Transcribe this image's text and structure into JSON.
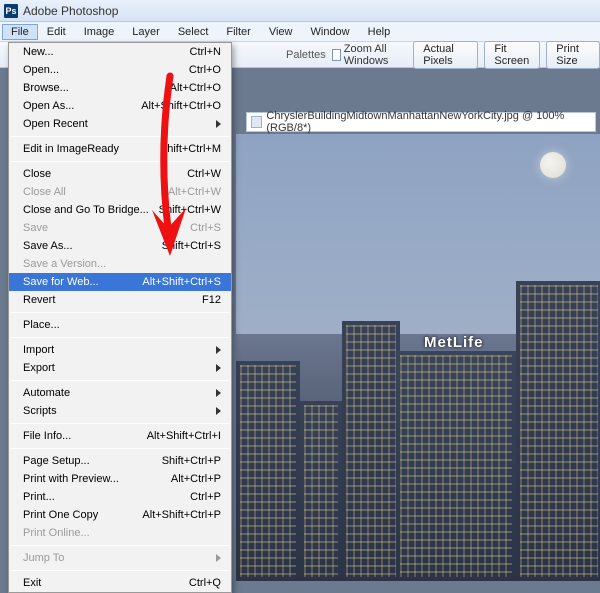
{
  "app": {
    "title": "Adobe Photoshop",
    "icon_label": "Ps"
  },
  "menubar": {
    "items": [
      "File",
      "Edit",
      "Image",
      "Layer",
      "Select",
      "Filter",
      "View",
      "Window",
      "Help"
    ],
    "open_index": 0
  },
  "optionsbar": {
    "palettes_label": "Palettes",
    "zoom_checkbox_label": "Zoom All Windows",
    "buttons": {
      "actual": "Actual Pixels",
      "fit": "Fit Screen",
      "printsize": "Print Size"
    }
  },
  "document": {
    "icon": "document-icon",
    "filename": "ChryslerBuildingMidtownManhattanNewYorkCity.jpg",
    "zoom": "100%",
    "mode": "RGB/8*"
  },
  "dropdown": {
    "items": [
      {
        "label": "New...",
        "shortcut": "Ctrl+N"
      },
      {
        "label": "Open...",
        "shortcut": "Ctrl+O"
      },
      {
        "label": "Browse...",
        "shortcut": "Alt+Ctrl+O"
      },
      {
        "label": "Open As...",
        "shortcut": "Alt+Shift+Ctrl+O"
      },
      {
        "label": "Open Recent",
        "submenu": true
      },
      {
        "sep": true
      },
      {
        "label": "Edit in ImageReady",
        "shortcut": "Shift+Ctrl+M"
      },
      {
        "sep": true
      },
      {
        "label": "Close",
        "shortcut": "Ctrl+W"
      },
      {
        "label": "Close All",
        "shortcut": "Alt+Ctrl+W",
        "disabled": true
      },
      {
        "label": "Close and Go To Bridge...",
        "shortcut": "Shift+Ctrl+W"
      },
      {
        "label": "Save",
        "shortcut": "Ctrl+S",
        "disabled": true
      },
      {
        "label": "Save As...",
        "shortcut": "Shift+Ctrl+S"
      },
      {
        "label": "Save a Version...",
        "disabled": true
      },
      {
        "label": "Save for Web...",
        "shortcut": "Alt+Shift+Ctrl+S",
        "highlight": true
      },
      {
        "label": "Revert",
        "shortcut": "F12"
      },
      {
        "sep": true
      },
      {
        "label": "Place..."
      },
      {
        "sep": true
      },
      {
        "label": "Import",
        "submenu": true
      },
      {
        "label": "Export",
        "submenu": true
      },
      {
        "sep": true
      },
      {
        "label": "Automate",
        "submenu": true
      },
      {
        "label": "Scripts",
        "submenu": true
      },
      {
        "sep": true
      },
      {
        "label": "File Info...",
        "shortcut": "Alt+Shift+Ctrl+I"
      },
      {
        "sep": true
      },
      {
        "label": "Page Setup...",
        "shortcut": "Shift+Ctrl+P"
      },
      {
        "label": "Print with Preview...",
        "shortcut": "Alt+Ctrl+P"
      },
      {
        "label": "Print...",
        "shortcut": "Ctrl+P"
      },
      {
        "label": "Print One Copy",
        "shortcut": "Alt+Shift+Ctrl+P"
      },
      {
        "label": "Print Online...",
        "disabled": true
      },
      {
        "sep": true
      },
      {
        "label": "Jump To",
        "submenu": true,
        "disabled": true
      },
      {
        "sep": true
      },
      {
        "label": "Exit",
        "shortcut": "Ctrl+Q"
      }
    ]
  },
  "canvas": {
    "sign_text": "MetLife"
  }
}
